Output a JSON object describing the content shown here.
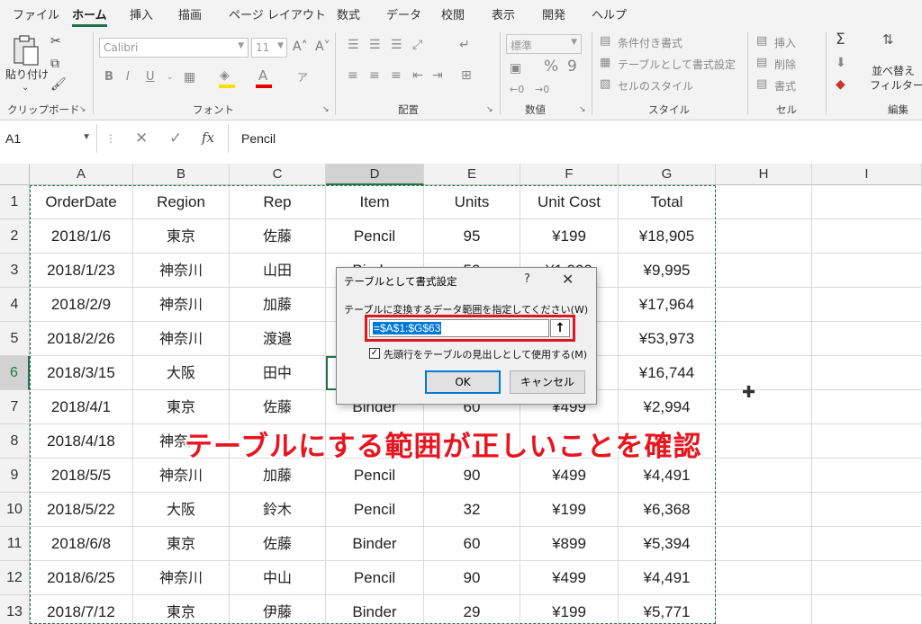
{
  "ribbon": {
    "tabs": [
      "ファイル",
      "ホーム",
      "挿入",
      "描画",
      "ページ レイアウト",
      "数式",
      "データ",
      "校閲",
      "表示",
      "開発",
      "ヘルプ"
    ],
    "active_tab": "ホーム",
    "clipboard": {
      "paste_label": "貼り付け",
      "group_label": "クリップボード"
    },
    "font": {
      "font_name": "Calibri",
      "font_size": "11",
      "group_label": "フォント",
      "bold": "B",
      "italic": "I",
      "underline": "U",
      "grow": "A^",
      "shrink": "A˅",
      "ruby": "ア",
      "font_color_letter": "A"
    },
    "alignment": {
      "group_label": "配置"
    },
    "number": {
      "format": "標準",
      "percent": "%",
      "comma": "9",
      "group_label": "数値"
    },
    "styles": {
      "conditional": "条件付き書式",
      "as_table": "テーブルとして書式設定",
      "cell_styles": "セルのスタイル",
      "group_label": "スタイル"
    },
    "cells": {
      "insert": "挿入",
      "delete": "削除",
      "format": "書式",
      "group_label": "セル"
    },
    "editing": {
      "sort_filter": "並べ替え",
      "filter": "フィルター",
      "group_label": "編集"
    }
  },
  "formula_bar": {
    "name_box": "A1",
    "cancel": "✕",
    "enter": "✓",
    "fx": "fx",
    "formula": "Pencil"
  },
  "columns": [
    "A",
    "B",
    "C",
    "D",
    "E",
    "F",
    "G",
    "H",
    "I"
  ],
  "selected_column": "D",
  "rows": [
    "1",
    "2",
    "3",
    "4",
    "5",
    "6",
    "7",
    "8",
    "9",
    "10",
    "11",
    "12",
    "13"
  ],
  "selected_row": "6",
  "header": [
    "OrderDate",
    "Region",
    "Rep",
    "Item",
    "Units",
    "Unit Cost",
    "Total"
  ],
  "data_rows": [
    [
      "2018/1/6",
      "東京",
      "佐藤",
      "Pencil",
      "95",
      "¥199",
      "¥18,905"
    ],
    [
      "2018/1/23",
      "神奈川",
      "山田",
      "Binder",
      "50",
      "¥1,999",
      "¥9,995"
    ],
    [
      "2018/2/9",
      "神奈川",
      "加藤",
      "",
      "",
      "",
      "¥17,964"
    ],
    [
      "2018/2/26",
      "神奈川",
      "渡邉",
      "",
      "",
      "",
      "¥53,973"
    ],
    [
      "2018/3/15",
      "大阪",
      "田中",
      "",
      "",
      "",
      "¥16,744"
    ],
    [
      "2018/4/1",
      "東京",
      "佐藤",
      "Binder",
      "60",
      "¥499",
      "¥2,994"
    ],
    [
      "2018/4/18",
      "神奈川",
      "",
      "",
      "",
      "",
      ""
    ],
    [
      "2018/5/5",
      "神奈川",
      "加藤",
      "Pencil",
      "90",
      "¥499",
      "¥4,491"
    ],
    [
      "2018/5/22",
      "大阪",
      "鈴木",
      "Pencil",
      "32",
      "¥199",
      "¥6,368"
    ],
    [
      "2018/6/8",
      "東京",
      "佐藤",
      "Binder",
      "60",
      "¥899",
      "¥5,394"
    ],
    [
      "2018/6/25",
      "神奈川",
      "中山",
      "Pencil",
      "90",
      "¥499",
      "¥4,491"
    ],
    [
      "2018/7/12",
      "東京",
      "伊藤",
      "Binder",
      "29",
      "¥199",
      "¥5,771"
    ]
  ],
  "dialog": {
    "title": "テーブルとして書式設定",
    "help": "?",
    "close": "✕",
    "prompt": "テーブルに変換するデータ範囲を指定してください(W)",
    "range_value": "=$A$1:$G$63",
    "range_button": "🡅",
    "header_checkbox_label": "先頭行をテーブルの見出しとして使用する(M)",
    "header_checked": true,
    "ok_label": "OK",
    "cancel_label": "キャンセル"
  },
  "annotation": "テーブルにする範囲が正しいことを確認",
  "colors": {
    "excel_green": "#217346",
    "annotation_red": "#e8151f",
    "highlight_red": "#e0161e",
    "dialog_bg": "#f0f0f0"
  }
}
